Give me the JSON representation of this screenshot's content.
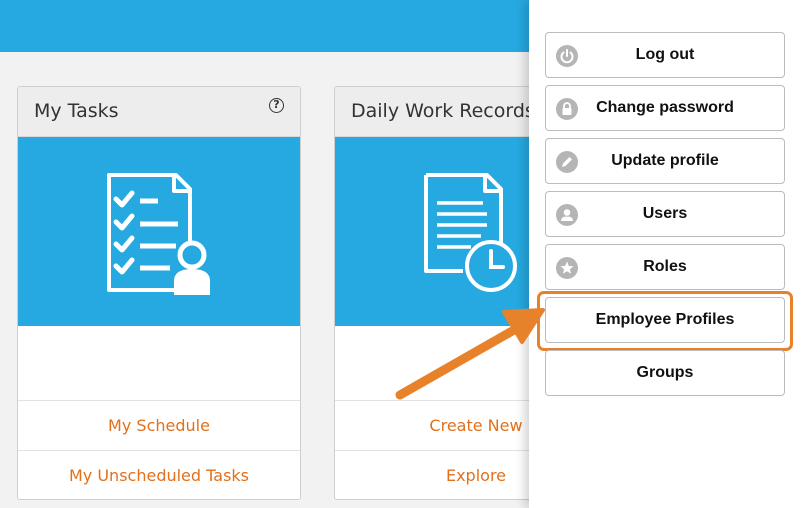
{
  "header": {
    "bar_color": "#26a9e1"
  },
  "cards": [
    {
      "title": "My Tasks",
      "help_glyph": "?",
      "icon": "checklist-user-icon",
      "links": [
        "My Schedule",
        "My Unscheduled Tasks"
      ]
    },
    {
      "title": "Daily Work Records",
      "icon": "document-clock-icon",
      "links": [
        "Create New",
        "Explore"
      ]
    }
  ],
  "user_menu": {
    "items": [
      {
        "label": "Log out",
        "icon": "power-icon"
      },
      {
        "label": "Change password",
        "icon": "lock-icon"
      },
      {
        "label": "Update profile",
        "icon": "pencil-icon"
      },
      {
        "label": "Users",
        "icon": "user-icon"
      },
      {
        "label": "Roles",
        "icon": "star-icon"
      },
      {
        "label": "Employee Profiles",
        "highlighted": true
      },
      {
        "label": "Groups"
      }
    ]
  },
  "colors": {
    "accent": "#26a9e1",
    "link": "#e2701c",
    "annotation": "#e7822a"
  }
}
